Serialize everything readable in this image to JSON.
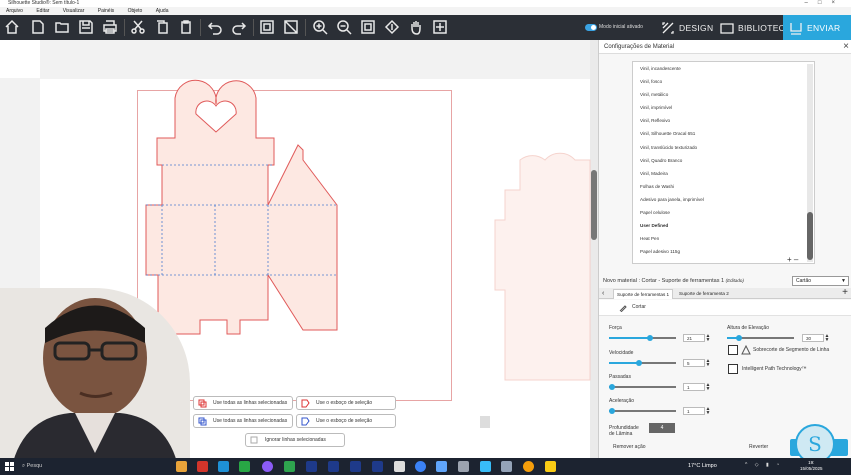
{
  "window": {
    "title": "Silhouette Studio®: Sem título-1",
    "controls": [
      "–",
      "□",
      "×"
    ]
  },
  "menu": [
    "Arquivo",
    "Editar",
    "Visualizar",
    "Painéis",
    "Objeto",
    "Ajuda"
  ],
  "toolbar": {
    "beginner_mode_label": "Modo inicial ativado",
    "tabs": {
      "design": "DESIGN",
      "library": "BIBLIOTECA",
      "send": "ENVIAR"
    }
  },
  "selection_buttons": {
    "use_all_red": "Use todas as linhas selecionadas",
    "outline_red": "Use o esboço de seleção",
    "use_all_blue": "Use todas as linhas selecionadas",
    "outline_blue": "Use o esboço de seleção",
    "ignore": "Ignorar linhas selecionadas"
  },
  "panel": {
    "title": "Configurações de Material",
    "close": "×",
    "materials": [
      "Vinil, incandescente",
      "Vinil, fosco",
      "Vinil, metálico",
      "Vinil, imprimível",
      "Vinil, Reflexivo",
      "Vinil, Silhouette Oracal 651",
      "Vinil, translúcido texturizado",
      "Vinil, Quadro Branco",
      "Vinil, Madeira",
      "Folhas de Washi",
      "Adesivo para janela, imprimível",
      "Papel celulose",
      "User Defined",
      "Heat Pen",
      "Papel adesivo 115g"
    ],
    "selected_material": "User Defined",
    "list_plus": "+",
    "list_minus": "–",
    "new_material_prefix": "Novo material : Cortar - Suporte de ferramentas 1",
    "new_material_edited": "(Editado)",
    "material_select": "Cartão",
    "tool_tabs": [
      "Suporte de ferramentas 1",
      "Suporte de ferramenta 2"
    ],
    "action_label": "Cortar",
    "force": {
      "label": "Força",
      "value": "21",
      "level": 0.62
    },
    "speed": {
      "label": "Velocidade",
      "value": "5",
      "level": 0.45
    },
    "passes": {
      "label": "Passadas",
      "value": "1",
      "level": 0.0
    },
    "acceleration": {
      "label": "Aceleração",
      "value": "1",
      "level": 0.0
    },
    "lift_height": {
      "label": "Altura de Elevação",
      "value": "30",
      "level": 0.15
    },
    "overcut_label": "Sobrecorte de Segmento de Linha",
    "intelligent_label": "Intelligent Path Technology™",
    "blade_depth_label_1": "Profundidade",
    "blade_depth_label_2": "de Lâmina",
    "blade_depth_value": "4",
    "remove_action": "Remover ação",
    "revert": "Reverter"
  },
  "taskbar": {
    "search_placeholder": "Pesqu",
    "weather": "17°C  Limpo",
    "time": "19:",
    "date": "15/05/2025"
  },
  "colors": {
    "accent": "#2aa7dd",
    "toolbar_bg": "#2b2f36",
    "cut_line": "#e05a5a",
    "shape_fill": "#fde8e2",
    "fold_line": "#4a7bd0"
  }
}
